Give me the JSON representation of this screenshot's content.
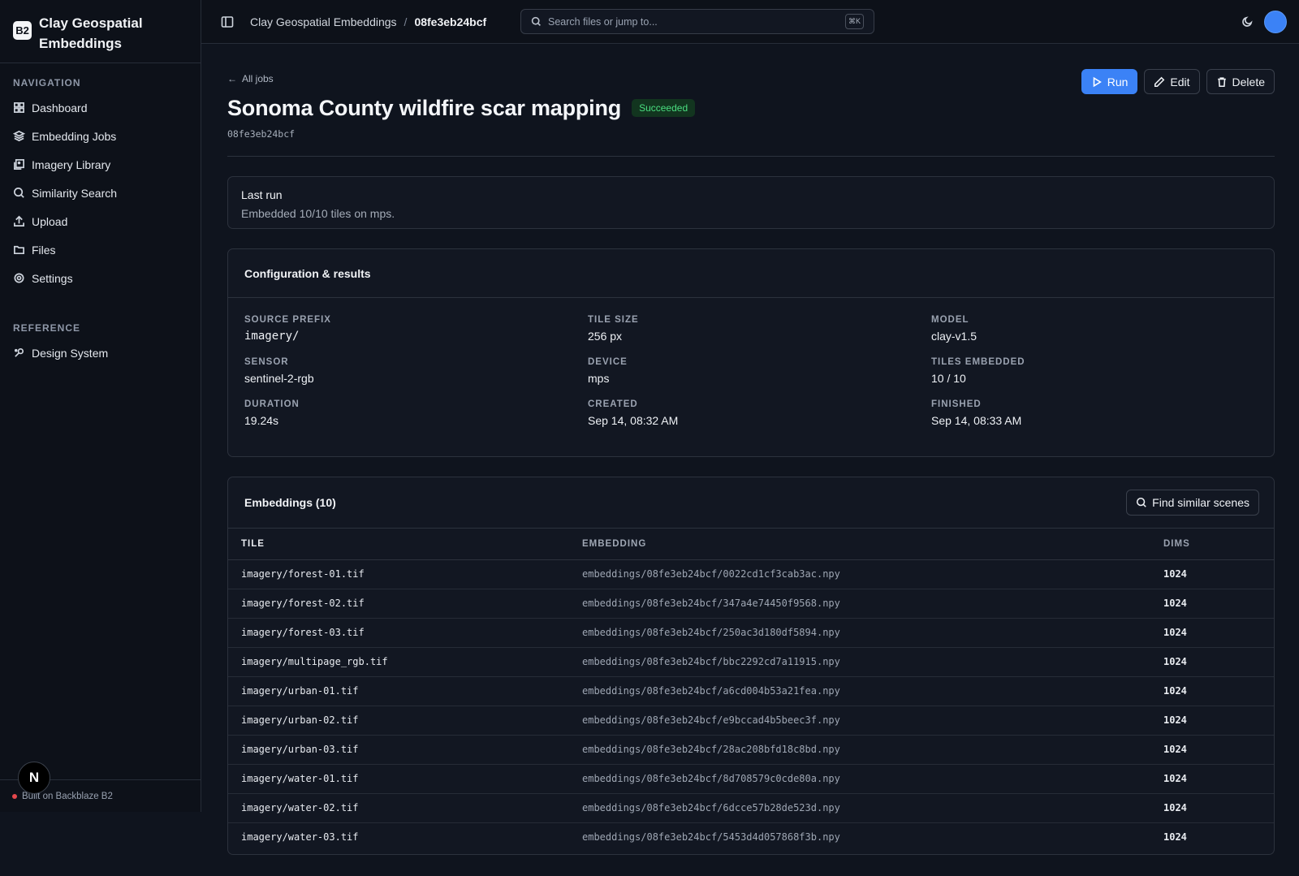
{
  "brand": {
    "logo": "B2",
    "title": "Clay Geospatial Embeddings"
  },
  "sidebar": {
    "nav_label": "NAVIGATION",
    "items": [
      {
        "label": "Dashboard",
        "icon": "dashboard-icon"
      },
      {
        "label": "Embedding Jobs",
        "icon": "layers-icon"
      },
      {
        "label": "Imagery Library",
        "icon": "images-icon"
      },
      {
        "label": "Similarity Search",
        "icon": "search-icon"
      },
      {
        "label": "Upload",
        "icon": "upload-icon"
      },
      {
        "label": "Files",
        "icon": "folder-icon"
      },
      {
        "label": "Settings",
        "icon": "gear-icon"
      }
    ],
    "ref_label": "REFERENCE",
    "ref_items": [
      {
        "label": "Design System",
        "icon": "palette-icon"
      }
    ],
    "footer": "Built on Backblaze B2",
    "badge": "N"
  },
  "topbar": {
    "breadcrumb_parent": "Clay Geospatial Embeddings",
    "breadcrumb_sep": "/",
    "breadcrumb_current": "08fe3eb24bcf",
    "search_placeholder": "Search files or jump to...",
    "search_shortcut": "⌘K"
  },
  "page": {
    "back_label": "All jobs",
    "title": "Sonoma County wildfire scar mapping",
    "status": "Succeeded",
    "job_id": "08fe3eb24bcf",
    "actions": {
      "run": "Run",
      "edit": "Edit",
      "delete": "Delete"
    }
  },
  "last_run": {
    "heading": "Last run",
    "summary": "Embedded 10/10 tiles on mps."
  },
  "config": {
    "heading": "Configuration & results",
    "fields": [
      {
        "key": "SOURCE PREFIX",
        "value": "imagery/"
      },
      {
        "key": "TILE SIZE",
        "value": "256 px"
      },
      {
        "key": "MODEL",
        "value": "clay-v1.5"
      },
      {
        "key": "SENSOR",
        "value": "sentinel-2-rgb"
      },
      {
        "key": "DEVICE",
        "value": "mps"
      },
      {
        "key": "TILES EMBEDDED",
        "value": "10 / 10"
      },
      {
        "key": "DURATION",
        "value": "19.24s"
      },
      {
        "key": "CREATED",
        "value": "Sep 14, 08:32 AM"
      },
      {
        "key": "FINISHED",
        "value": "Sep 14, 08:33 AM"
      }
    ]
  },
  "embeddings": {
    "heading": "Embeddings (10)",
    "find_label": "Find similar scenes",
    "columns": [
      "TILE",
      "EMBEDDING",
      "DIMS"
    ],
    "rows": [
      [
        "imagery/forest-01.tif",
        "embeddings/08fe3eb24bcf/0022cd1cf3cab3ac.npy",
        "1024"
      ],
      [
        "imagery/forest-02.tif",
        "embeddings/08fe3eb24bcf/347a4e74450f9568.npy",
        "1024"
      ],
      [
        "imagery/forest-03.tif",
        "embeddings/08fe3eb24bcf/250ac3d180df5894.npy",
        "1024"
      ],
      [
        "imagery/multipage_rgb.tif",
        "embeddings/08fe3eb24bcf/bbc2292cd7a11915.npy",
        "1024"
      ],
      [
        "imagery/urban-01.tif",
        "embeddings/08fe3eb24bcf/a6cd004b53a21fea.npy",
        "1024"
      ],
      [
        "imagery/urban-02.tif",
        "embeddings/08fe3eb24bcf/e9bccad4b5beec3f.npy",
        "1024"
      ],
      [
        "imagery/urban-03.tif",
        "embeddings/08fe3eb24bcf/28ac208bfd18c8bd.npy",
        "1024"
      ],
      [
        "imagery/water-01.tif",
        "embeddings/08fe3eb24bcf/8d708579c0cde80a.npy",
        "1024"
      ],
      [
        "imagery/water-02.tif",
        "embeddings/08fe3eb24bcf/6dcce57b28de523d.npy",
        "1024"
      ],
      [
        "imagery/water-03.tif",
        "embeddings/08fe3eb24bcf/5453d4d057868f3b.npy",
        "1024"
      ]
    ]
  },
  "colors": {
    "accent": "#3b82f6",
    "success": "#4ade80",
    "background": "#0f141e",
    "danger_dot": "#e5484d"
  }
}
